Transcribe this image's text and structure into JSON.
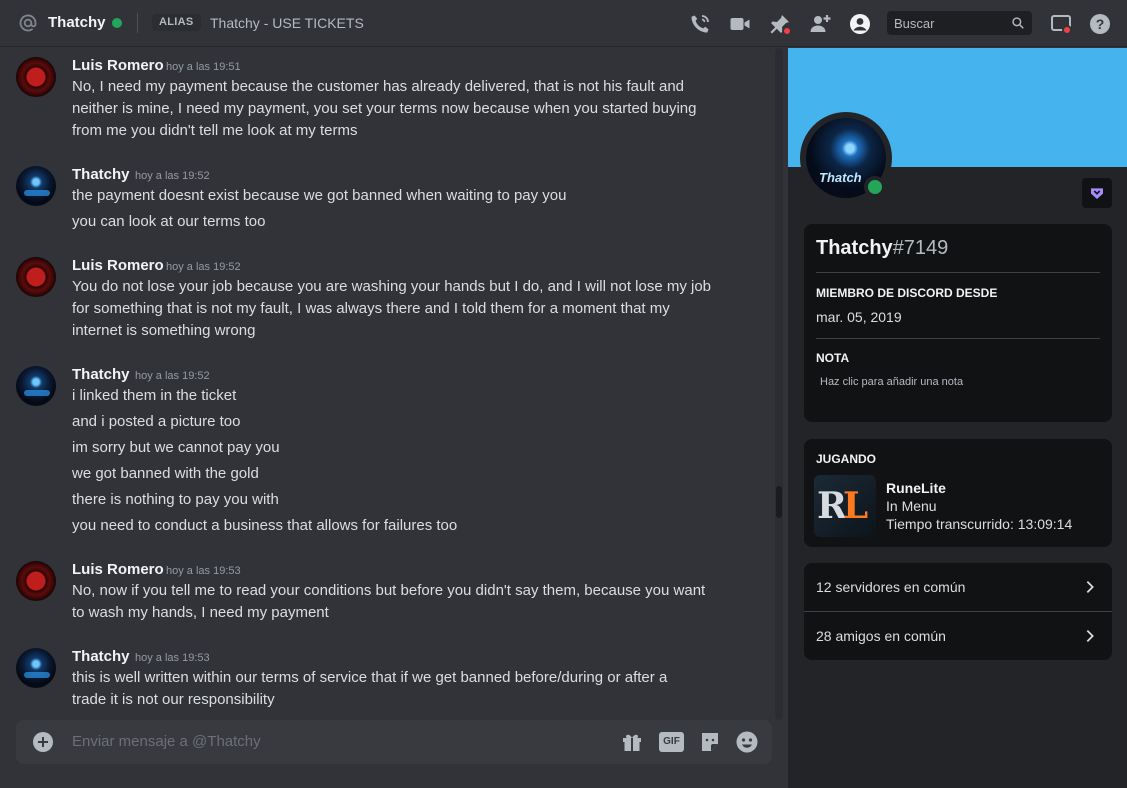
{
  "header": {
    "title": "Thatchy",
    "alias_badge": "ALIAS",
    "alias_text": "Thatchy - USE TICKETS",
    "search_placeholder": "Buscar",
    "icons": [
      "call-icon",
      "video-icon",
      "pin-icon",
      "add-friend-icon",
      "profile-toggle-icon",
      "inbox-icon",
      "help-icon"
    ]
  },
  "messages": [
    {
      "author": "Luis Romero",
      "time": "hoy a las 19:51",
      "avatar": "luis",
      "lines": [
        "No, I need my payment because the customer has already delivered, that is not his fault and",
        "neither is mine, I need my payment, you set your terms now because when you started buying",
        "from me you didn't tell me look at my terms"
      ]
    },
    {
      "author": "Thatchy",
      "time": "hoy a las 19:52",
      "avatar": "thatchy",
      "lines": [
        "the payment doesnt exist because we got banned when waiting to pay you",
        "you can look at our terms too"
      ]
    },
    {
      "author": "Luis Romero",
      "time": "hoy a las 19:52",
      "avatar": "luis",
      "lines": [
        "You do not lose your job because you are washing your hands but I do, and I will not lose my job",
        "for something that is not my fault, I was always there and I told them for a moment that my",
        "internet is something wrong"
      ]
    },
    {
      "author": "Thatchy",
      "time": "hoy a las 19:52",
      "avatar": "thatchy",
      "lines": [
        "i linked them in the ticket",
        "and i posted a picture too",
        "im sorry but we cannot pay you",
        "we got banned with the gold",
        "there is nothing to pay you with",
        "you need to conduct a business that allows for failures too"
      ]
    },
    {
      "author": "Luis Romero",
      "time": "hoy a las 19:53",
      "avatar": "luis",
      "lines": [
        "No, now if you tell me to read your conditions but before you didn't say them, because you want",
        "to wash my hands, I need my payment"
      ]
    },
    {
      "author": "Thatchy",
      "time": "hoy a las 19:53",
      "avatar": "thatchy",
      "lines": [
        "this is well written within our terms of service that if we get banned before/during or after a",
        "trade it is not our responsibility"
      ]
    }
  ],
  "composer": {
    "placeholder": "Enviar mensaje a @Thatchy",
    "gif_label": "GIF"
  },
  "profile": {
    "username": "Thatchy",
    "discriminator": "#7149",
    "avatar_text": "Thatch",
    "member_since_label": "MIEMBRO DE DISCORD DESDE",
    "member_since": "mar. 05, 2019",
    "note_label": "NOTA",
    "note_placeholder": "Haz clic para añadir una nota",
    "activity_label": "JUGANDO",
    "game_logo_a": "R",
    "game_logo_b": "L",
    "game_name": "RuneLite",
    "game_state": "In Menu",
    "game_elapsed": "Tiempo transcurrido: 13:09:14",
    "mutual_servers": "12 servidores en común",
    "mutual_friends": "28 amigos en común"
  },
  "colors": {
    "banner": "#45b3ed",
    "online": "#23a55a",
    "accent": "#5865f2",
    "nitro": "#a78bfa"
  }
}
